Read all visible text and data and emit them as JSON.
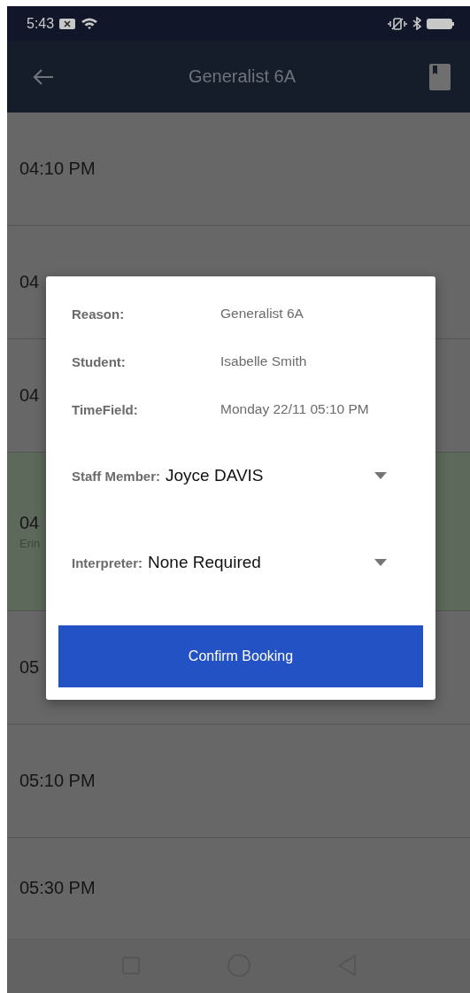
{
  "status_bar": {
    "time": "5:43"
  },
  "app_bar": {
    "title": "Generalist 6A"
  },
  "slots": [
    {
      "time": "04:10 PM",
      "kind": "plain"
    },
    {
      "time": "04",
      "kind": "plain"
    },
    {
      "time": "04",
      "kind": "plain"
    },
    {
      "time": "04",
      "subtitle": "Erin",
      "kind": "booked"
    },
    {
      "time": "05",
      "kind": "plain"
    },
    {
      "time": "05:10 PM",
      "kind": "plain"
    },
    {
      "time": "05:30 PM",
      "kind": "plain"
    }
  ],
  "dialog": {
    "details": [
      {
        "label": "Reason:",
        "value": "Generalist 6A"
      },
      {
        "label": "Student:",
        "value": "Isabelle Smith"
      },
      {
        "label": "TimeField:",
        "value": "Monday 22/11 05:10 PM"
      }
    ],
    "dropdowns": [
      {
        "label": "Staff Member:",
        "value": "Joyce DAVIS"
      },
      {
        "label": "Interpreter:",
        "value": "None Required"
      }
    ],
    "button": "Confirm Booking"
  }
}
